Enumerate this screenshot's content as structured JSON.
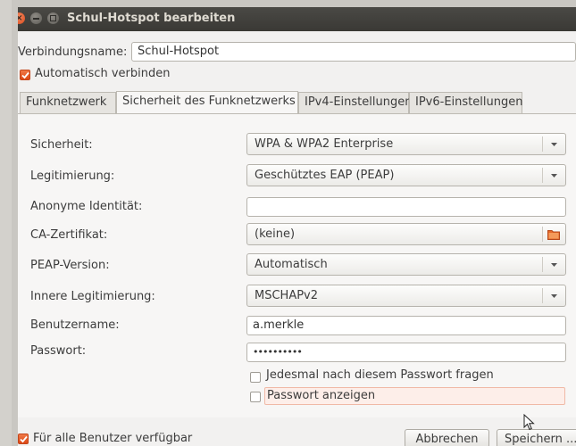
{
  "window": {
    "title": "Schul-Hotspot bearbeiten"
  },
  "connection": {
    "name_label": "Verbindungsname:",
    "name_value": "Schul-Hotspot",
    "auto_connect_label": "Automatisch verbinden",
    "auto_connect_checked": true
  },
  "tabs": [
    {
      "label": "Funknetzwerk"
    },
    {
      "label": "Sicherheit des Funknetzwerks",
      "active": true
    },
    {
      "label": "IPv4-Einstellungen"
    },
    {
      "label": "IPv6-Einstellungen"
    }
  ],
  "security": {
    "security_label": "Sicherheit:",
    "security_value": "WPA & WPA2 Enterprise",
    "auth_label": "Legitimierung:",
    "auth_value": "Geschütztes EAP (PEAP)",
    "anon_label": "Anonyme Identität:",
    "anon_value": "",
    "ca_label": "CA-Zertifikat:",
    "ca_value": "(keine)",
    "peap_label": "PEAP-Version:",
    "peap_value": "Automatisch",
    "inner_label": "Innere Legitimierung:",
    "inner_value": "MSCHAPv2",
    "user_label": "Benutzername:",
    "user_value": "a.merkle",
    "pass_label": "Passwort:",
    "pass_value": "••••••••••",
    "ask_label": "Jedesmal nach diesem Passwort fragen",
    "ask_checked": false,
    "show_label": "Passwort anzeigen",
    "show_checked": false
  },
  "footer": {
    "all_users_label": "Für alle Benutzer verfügbar",
    "all_users_checked": true,
    "cancel_label": "Abbrechen",
    "save_label": "Speichern ..."
  },
  "colors": {
    "accent": "#dd4814",
    "titlebar": "#3c3b37",
    "window_bg": "#f2f1f0"
  }
}
